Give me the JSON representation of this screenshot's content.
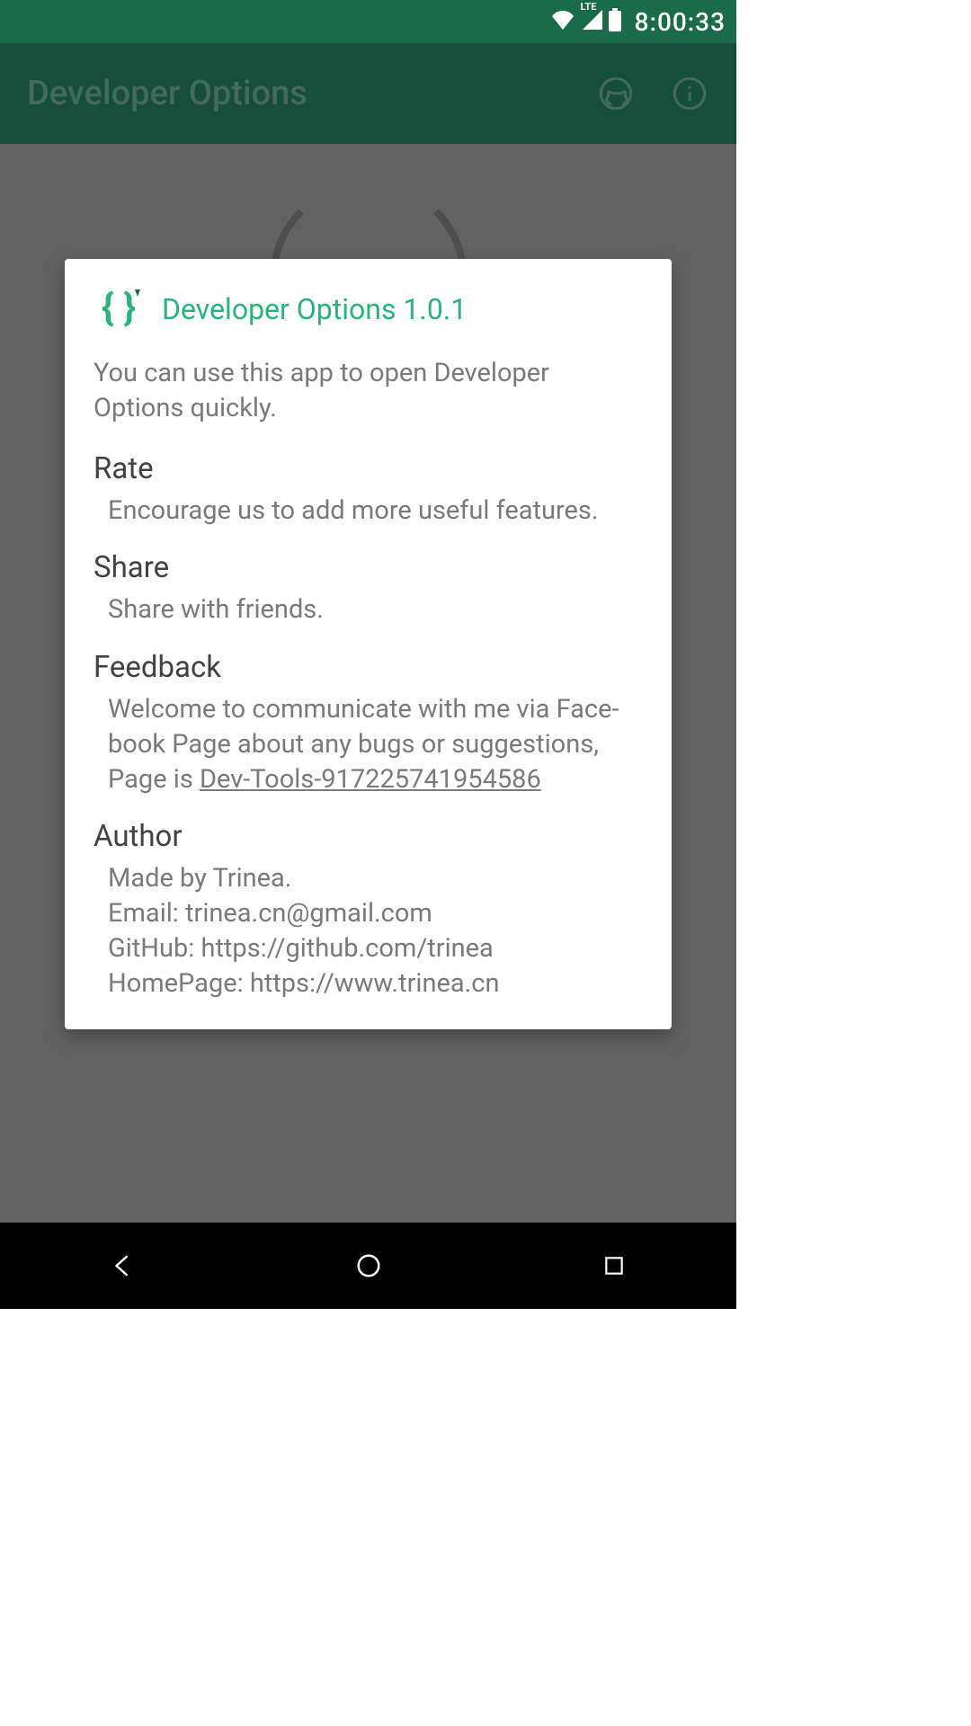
{
  "status_bar": {
    "lte_label": "LTE",
    "time": "8:00:33"
  },
  "action_bar": {
    "title": "Developer Options"
  },
  "dialog": {
    "title": "Developer Options 1.0.1",
    "intro": "You can use this app to open Developer Options quickly.",
    "sections": {
      "rate": {
        "heading": "Rate",
        "body": "Encourage us to add more useful features."
      },
      "share": {
        "heading": "Share",
        "body": "Share with friends."
      },
      "feedback": {
        "heading": "Feedback",
        "body_pre": "Welcome to communicate with me via Face­book Page about any bugs or suggestions, Page is ",
        "link_text": "Dev-Tools-917225741954586"
      },
      "author": {
        "heading": "Author",
        "body": "Made by Trinea.\nEmail: trinea.cn@gmail.com\nGitHub: https://github.com/trinea\nHomePage: https://www.trinea.cn"
      }
    }
  },
  "colors": {
    "status_bar_bg": "#1a6b4a",
    "action_bar_bg": "#238060",
    "accent": "#28b37f"
  }
}
